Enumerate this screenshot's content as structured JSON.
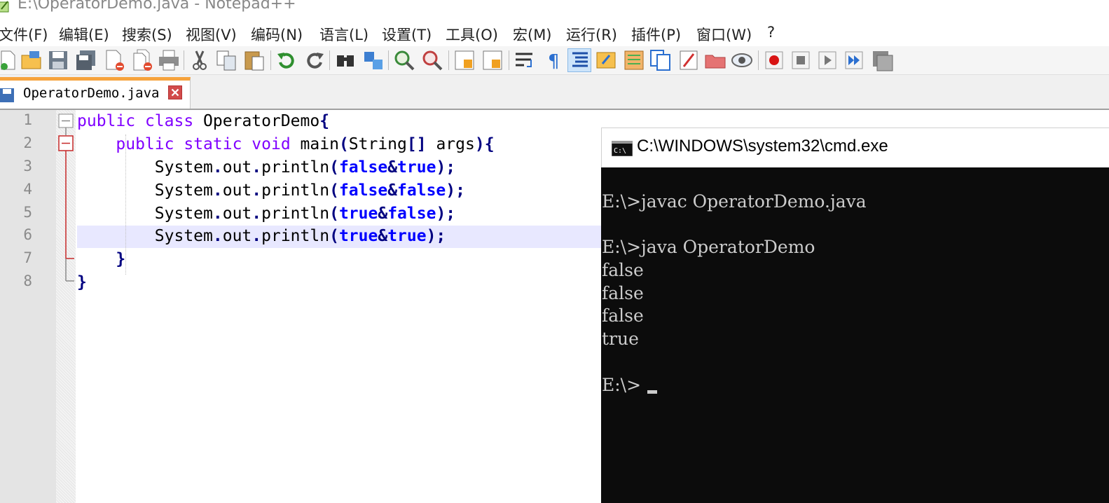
{
  "window": {
    "title": "E:\\OperatorDemo.java - Notepad++"
  },
  "menu": {
    "items": [
      "文件(F)",
      "编辑(E)",
      "搜索(S)",
      "视图(V)",
      "编码(N)",
      "语言(L)",
      "设置(T)",
      "工具(O)",
      "宏(M)",
      "运行(R)",
      "插件(P)",
      "窗口(W)"
    ],
    "help": "?"
  },
  "toolbar": {
    "icons": [
      "new-file-icon",
      "open-folder-icon",
      "save-icon",
      "save-all-icon",
      "close-icon",
      "close-all-icon",
      "print-icon",
      "cut-icon",
      "copy-icon",
      "paste-icon",
      "undo-icon",
      "redo-icon",
      "find-icon",
      "replace-icon",
      "zoom-in-icon",
      "zoom-out-icon",
      "sync-vertical-icon",
      "sync-horizontal-icon",
      "word-wrap-icon",
      "show-all-chars-icon",
      "indent-guide-icon",
      "user-defined-language-icon",
      "document-map-icon",
      "function-list-icon",
      "folder-workspace-icon",
      "monitoring-icon",
      "macro-record-icon",
      "macro-stop-icon",
      "macro-play-icon",
      "macro-run-multiple-icon",
      "macro-save-icon"
    ],
    "active_icon": "indent-guide-icon"
  },
  "tab": {
    "label": "OperatorDemo.java"
  },
  "editor": {
    "line_numbers": [
      "1",
      "2",
      "3",
      "4",
      "5",
      "6",
      "7",
      "8"
    ],
    "current_line": 6,
    "lines": [
      [
        {
          "t": "public",
          "c": "kw"
        },
        {
          "t": " "
        },
        {
          "t": "class",
          "c": "kw"
        },
        {
          "t": " OperatorDemo"
        },
        {
          "t": "{",
          "c": "op"
        }
      ],
      [
        {
          "t": "    "
        },
        {
          "t": "public",
          "c": "kw"
        },
        {
          "t": " "
        },
        {
          "t": "static",
          "c": "kw"
        },
        {
          "t": " "
        },
        {
          "t": "void",
          "c": "kw"
        },
        {
          "t": " main"
        },
        {
          "t": "(",
          "c": "op"
        },
        {
          "t": "String"
        },
        {
          "t": "[]",
          "c": "op"
        },
        {
          "t": " args"
        },
        {
          "t": "){",
          "c": "op"
        }
      ],
      [
        {
          "t": "        System"
        },
        {
          "t": ".",
          "c": "op"
        },
        {
          "t": "out"
        },
        {
          "t": ".",
          "c": "op"
        },
        {
          "t": "println"
        },
        {
          "t": "(",
          "c": "op"
        },
        {
          "t": "false",
          "c": "lit"
        },
        {
          "t": "&",
          "c": "op"
        },
        {
          "t": "true",
          "c": "lit"
        },
        {
          "t": ");",
          "c": "op"
        }
      ],
      [
        {
          "t": "        System"
        },
        {
          "t": ".",
          "c": "op"
        },
        {
          "t": "out"
        },
        {
          "t": ".",
          "c": "op"
        },
        {
          "t": "println"
        },
        {
          "t": "(",
          "c": "op"
        },
        {
          "t": "false",
          "c": "lit"
        },
        {
          "t": "&",
          "c": "op"
        },
        {
          "t": "false",
          "c": "lit"
        },
        {
          "t": ");",
          "c": "op"
        }
      ],
      [
        {
          "t": "        System"
        },
        {
          "t": ".",
          "c": "op"
        },
        {
          "t": "out"
        },
        {
          "t": ".",
          "c": "op"
        },
        {
          "t": "println"
        },
        {
          "t": "(",
          "c": "op"
        },
        {
          "t": "true",
          "c": "lit"
        },
        {
          "t": "&",
          "c": "op"
        },
        {
          "t": "false",
          "c": "lit"
        },
        {
          "t": ");",
          "c": "op"
        }
      ],
      [
        {
          "t": "        System"
        },
        {
          "t": ".",
          "c": "op"
        },
        {
          "t": "out"
        },
        {
          "t": ".",
          "c": "op"
        },
        {
          "t": "println"
        },
        {
          "t": "(",
          "c": "op"
        },
        {
          "t": "true",
          "c": "lit"
        },
        {
          "t": "&",
          "c": "op"
        },
        {
          "t": "true",
          "c": "lit"
        },
        {
          "t": ");",
          "c": "op"
        }
      ],
      [
        {
          "t": "    "
        },
        {
          "t": "}",
          "c": "op"
        }
      ],
      [
        {
          "t": "}",
          "c": "op"
        }
      ]
    ]
  },
  "cmd": {
    "title": "C:\\WINDOWS\\system32\\cmd.exe",
    "lines": [
      "",
      "E:\\>javac OperatorDemo.java",
      "",
      "E:\\>java OperatorDemo",
      "false",
      "false",
      "false",
      "true",
      "",
      "E:\\>"
    ]
  },
  "colors": {
    "keyword": "#8000ff",
    "operator": "#000080",
    "literal": "#0000ff",
    "tab_accent": "#f6a33c",
    "console_bg": "#0c0c0c"
  }
}
